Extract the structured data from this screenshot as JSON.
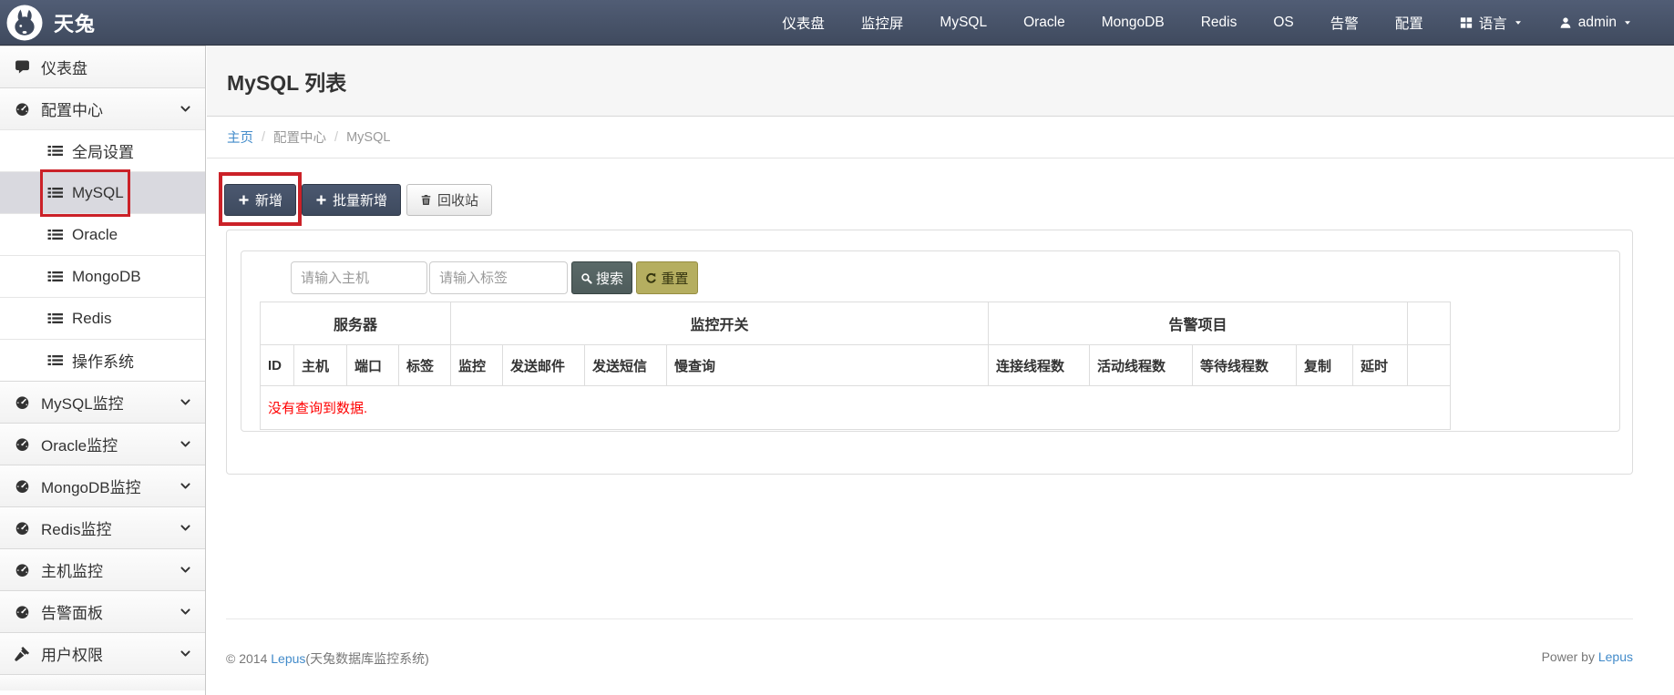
{
  "navbar": {
    "brand": "天兔",
    "items": [
      {
        "key": "dashboard",
        "label": "仪表盘"
      },
      {
        "key": "monitor-screen",
        "label": "监控屏"
      },
      {
        "key": "mysql",
        "label": "MySQL"
      },
      {
        "key": "oracle",
        "label": "Oracle"
      },
      {
        "key": "mongodb",
        "label": "MongoDB"
      },
      {
        "key": "redis",
        "label": "Redis"
      },
      {
        "key": "os",
        "label": "OS"
      },
      {
        "key": "alarm",
        "label": "告警"
      },
      {
        "key": "config",
        "label": "配置"
      },
      {
        "key": "language",
        "label": "语言",
        "icon": "grid",
        "caret": true
      },
      {
        "key": "admin",
        "label": "admin",
        "icon": "user",
        "caret": true
      }
    ]
  },
  "sidebar": {
    "items": [
      {
        "key": "dashboard",
        "label": "仪表盘",
        "icon": "comment",
        "type": "section"
      },
      {
        "key": "config-center",
        "label": "配置中心",
        "icon": "dashboard",
        "type": "section",
        "chevron": true
      },
      {
        "key": "global-settings",
        "label": "全局设置",
        "icon": "list",
        "type": "sub"
      },
      {
        "key": "mysql",
        "label": "MySQL",
        "icon": "list",
        "type": "sub",
        "active": true,
        "annotated": true
      },
      {
        "key": "oracle",
        "label": "Oracle",
        "icon": "list",
        "type": "sub"
      },
      {
        "key": "mongodb",
        "label": "MongoDB",
        "icon": "list",
        "type": "sub"
      },
      {
        "key": "redis",
        "label": "Redis",
        "icon": "list",
        "type": "sub"
      },
      {
        "key": "os",
        "label": "操作系统",
        "icon": "list",
        "type": "sub"
      },
      {
        "key": "mysql-monitor",
        "label": "MySQL监控",
        "icon": "dashboard",
        "type": "section",
        "chevron": true
      },
      {
        "key": "oracle-monitor",
        "label": "Oracle监控",
        "icon": "dashboard",
        "type": "section",
        "chevron": true
      },
      {
        "key": "mongodb-monitor",
        "label": "MongoDB监控",
        "icon": "dashboard",
        "type": "section",
        "chevron": true
      },
      {
        "key": "redis-monitor",
        "label": "Redis监控",
        "icon": "dashboard",
        "type": "section",
        "chevron": true
      },
      {
        "key": "host-monitor",
        "label": "主机监控",
        "icon": "dashboard",
        "type": "section",
        "chevron": true
      },
      {
        "key": "alarm-panel",
        "label": "告警面板",
        "icon": "dashboard",
        "type": "section",
        "chevron": true
      },
      {
        "key": "user-privileges",
        "label": "用户权限",
        "icon": "gavel",
        "type": "section",
        "chevron": true
      }
    ]
  },
  "page": {
    "title": "MySQL 列表",
    "breadcrumb_separator": "/",
    "breadcrumb": [
      {
        "label": "主页",
        "link": true
      },
      {
        "label": "配置中心",
        "link": false
      },
      {
        "label": "MySQL",
        "link": false
      }
    ]
  },
  "toolbar": {
    "add_label": "新增",
    "batch_add_label": "批量新增",
    "recycle_label": "回收站"
  },
  "search": {
    "host_placeholder": "请输入主机",
    "tag_placeholder": "请输入标签",
    "search_label": "搜索",
    "reset_label": "重置"
  },
  "table": {
    "groups": [
      {
        "label": "服务器",
        "span": 4
      },
      {
        "label": "监控开关",
        "span": 4
      },
      {
        "label": "告警项目",
        "span": 5
      },
      {
        "label": "",
        "span": 1
      }
    ],
    "columns": [
      "ID",
      "主机",
      "端口",
      "标签",
      "监控",
      "发送邮件",
      "发送短信",
      "慢查询",
      "连接线程数",
      "活动线程数",
      "等待线程数",
      "复制",
      "延时",
      ""
    ],
    "empty_message": "没有查询到数据."
  },
  "footer": {
    "copyright_prefix": "© 2014 ",
    "copyright_link": "Lepus",
    "copyright_suffix": "(天兔数据库监控系统)",
    "power_prefix": "Power by ",
    "power_link": "Lepus"
  },
  "colors": {
    "annotation-red": "#cb2128",
    "link-blue": "#428bca",
    "navbar-top": "#515d75",
    "navbar-bottom": "#3f4a5e",
    "btn-dark-top": "#4b5870",
    "btn-dark-bottom": "#3e4a5e",
    "search-btn": "#4e5c5b",
    "reset-btn": "#b5ae60",
    "error-red": "#ff0000",
    "active-item-bg": "#d9d9df"
  }
}
